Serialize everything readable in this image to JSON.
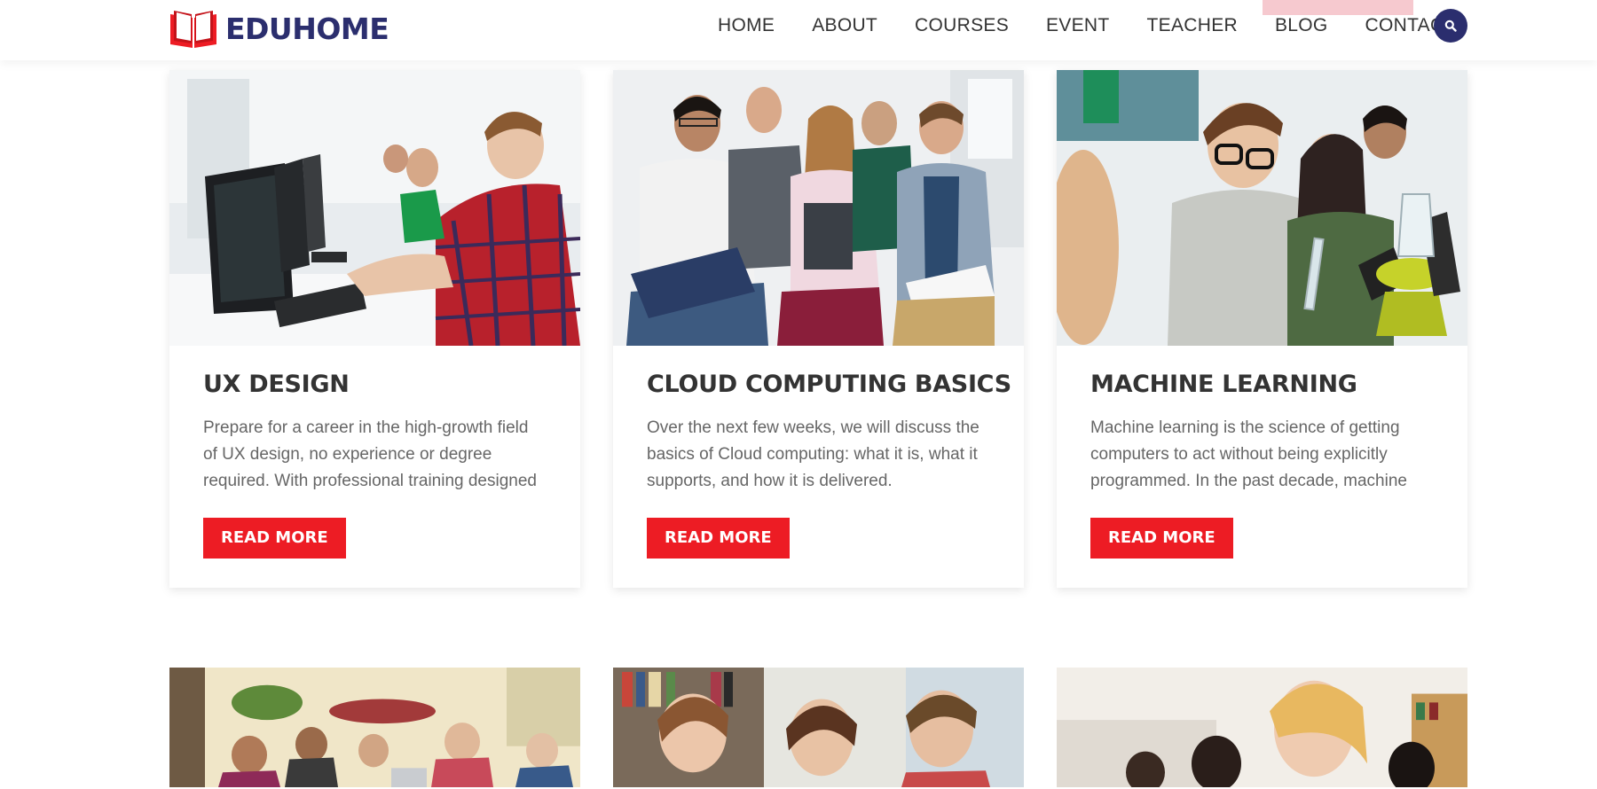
{
  "header": {
    "logo_text": "EDUHOME",
    "nav": [
      "HOME",
      "ABOUT",
      "COURSES",
      "EVENT",
      "TEACHER",
      "BLOG",
      "CONTACT"
    ],
    "search_icon": "search-icon"
  },
  "colors": {
    "brand_navy": "#2b2e6e",
    "accent_red": "#ed1c24",
    "highlight_pink": "#f6c9cf"
  },
  "courses": [
    {
      "title": "UX DESIGN",
      "description": "Prepare for a career in the high-growth field of UX design, no experience or degree required. With professional training designed by Google",
      "button": "READ MORE"
    },
    {
      "title": "CLOUD COMPUTING BASICS",
      "description": "Over the next few weeks, we will discuss the basics of Cloud computing: what it is, what it supports, and how it is delivered.",
      "button": "READ MORE"
    },
    {
      "title": "MACHINE LEARNING",
      "description": "Machine learning is the science of getting computers to act without being explicitly programmed. In the past decade, machine",
      "button": "READ MORE"
    }
  ]
}
